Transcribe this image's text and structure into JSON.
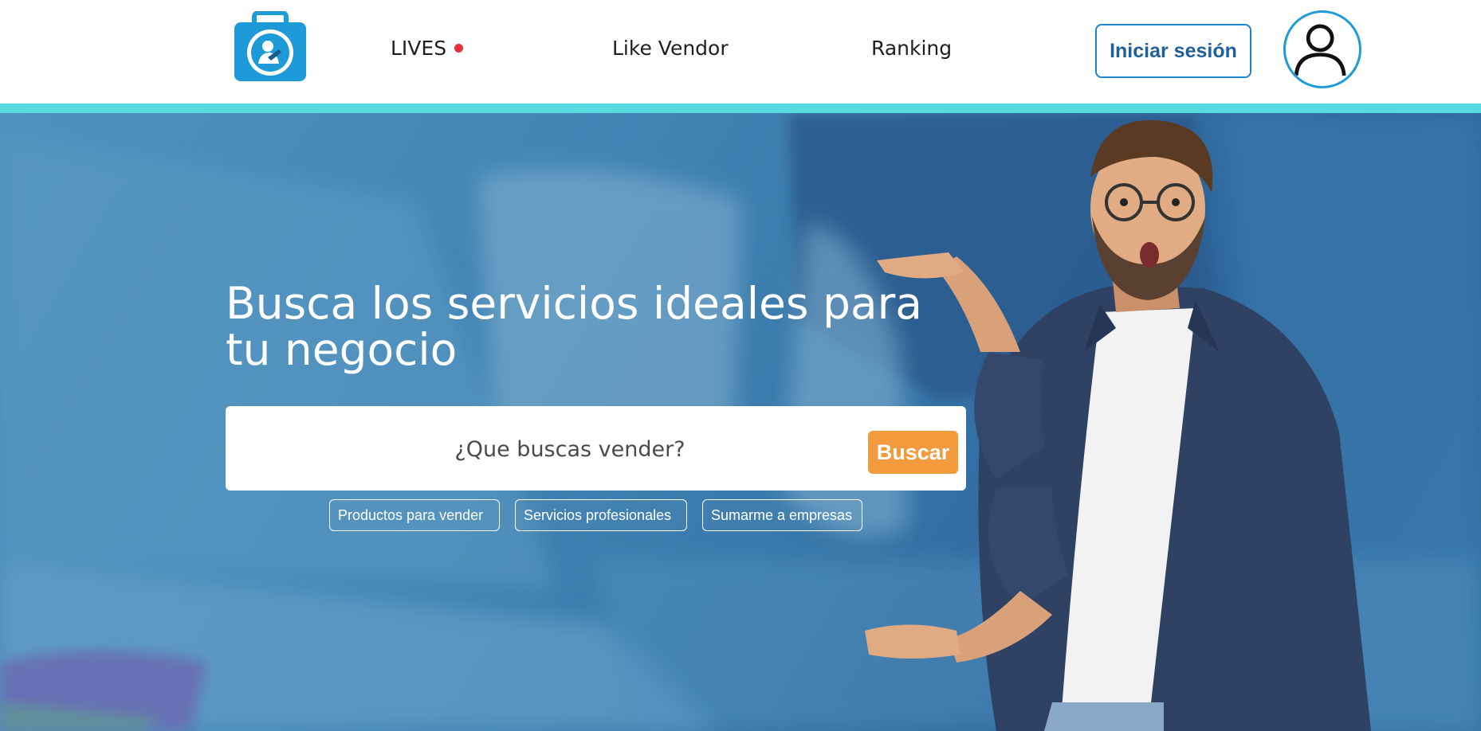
{
  "header": {
    "logo_icon": "briefcase-logo-icon",
    "nav": {
      "lives": "LIVES",
      "like_vendor": "Like Vendor",
      "ranking": "Ranking"
    },
    "login_label": "Iniciar sesión",
    "avatar_icon": "user-icon"
  },
  "hero": {
    "title": "Busca los servicios ideales para tu negocio",
    "search": {
      "placeholder": "¿Que buscas vender?",
      "button_label": "Buscar"
    },
    "chips": [
      "Productos para vender",
      "Servicios profesionales",
      "Sumarme a empresas"
    ]
  },
  "colors": {
    "accent_stripe": "#57dbe0",
    "primary_blue": "#1f86c9",
    "search_button": "#f39a3c",
    "live_dot": "#e5333b"
  }
}
